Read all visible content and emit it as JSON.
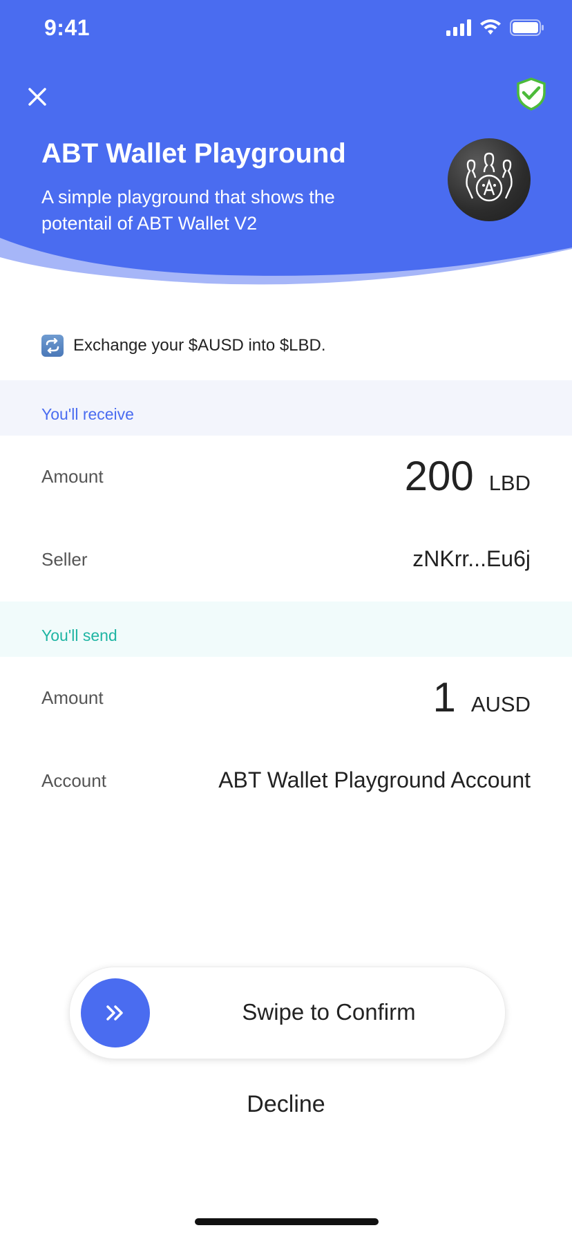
{
  "status_bar": {
    "time": "9:41"
  },
  "header": {
    "title": "ABT Wallet Playground",
    "description": "A simple playground that shows the potentail of ABT Wallet V2"
  },
  "exchange": {
    "text": "Exchange your $AUSD into $LBD."
  },
  "receive": {
    "section_label": "You'll receive",
    "amount_label": "Amount",
    "amount_value": "200",
    "amount_unit": "LBD",
    "seller_label": "Seller",
    "seller_value": "zNKrr...Eu6j"
  },
  "send": {
    "section_label": "You'll send",
    "amount_label": "Amount",
    "amount_value": "1",
    "amount_unit": "AUSD",
    "account_label": "Account",
    "account_value": "ABT Wallet Playground Account"
  },
  "actions": {
    "swipe_label": "Swipe to Confirm",
    "decline_label": "Decline"
  },
  "colors": {
    "brand_blue": "#4a6cf0",
    "receive_accent": "#4a6cf0",
    "send_accent": "#1fb5a3",
    "shield_green": "#4cbb3a"
  }
}
